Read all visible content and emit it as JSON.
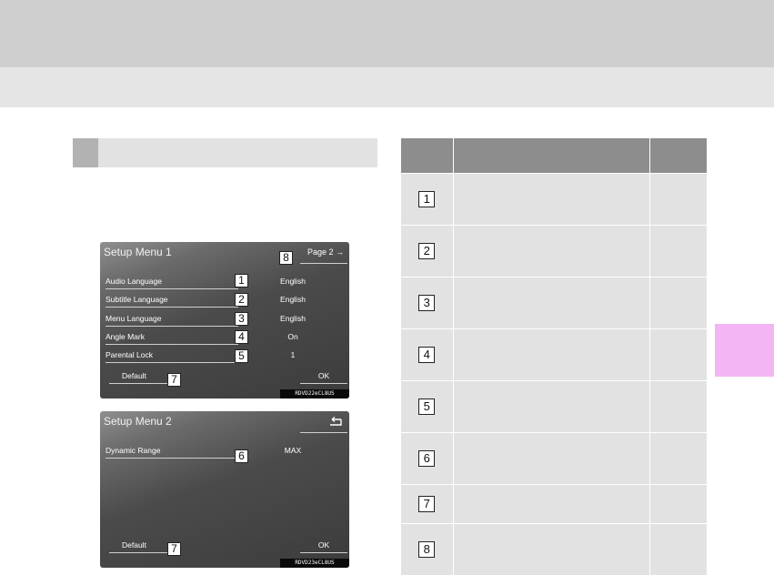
{
  "header": {},
  "setup_menu_1": {
    "title": "Setup Menu 1",
    "page_button": "Page 2 →",
    "rows": [
      {
        "label": "Audio Language",
        "value": "English",
        "callout": "1"
      },
      {
        "label": "Subtitle Language",
        "value": "English",
        "callout": "2"
      },
      {
        "label": "Menu Language",
        "value": "English",
        "callout": "3"
      },
      {
        "label": "Angle Mark",
        "value": "On",
        "callout": "4"
      },
      {
        "label": "Parental Lock",
        "value": "1",
        "callout": "5"
      }
    ],
    "default_label": "Default",
    "default_callout": "7",
    "page_callout": "8",
    "ok_label": "OK",
    "image_code": "RDVD22eCL8US"
  },
  "setup_menu_2": {
    "title": "Setup Menu 2",
    "back_icon": "return-arrow-icon",
    "rows": [
      {
        "label": "Dynamic Range",
        "value": "MAX",
        "callout": "6"
      }
    ],
    "default_label": "Default",
    "default_callout": "7",
    "ok_label": "OK",
    "image_code": "RDVD23eCL8US"
  },
  "reference_table": {
    "rows": [
      {
        "num": "1"
      },
      {
        "num": "2"
      },
      {
        "num": "3"
      },
      {
        "num": "4"
      },
      {
        "num": "5"
      },
      {
        "num": "6"
      },
      {
        "num": "7"
      },
      {
        "num": "8"
      }
    ]
  },
  "colors": {
    "header_dark": "#cfcfcf",
    "header_light": "#e5e5e5",
    "section_bar": "#e2e2e2",
    "table_header": "#8d8d8d",
    "table_cell": "#e2e2e2",
    "chapter_tab": "#f4b5f4"
  }
}
